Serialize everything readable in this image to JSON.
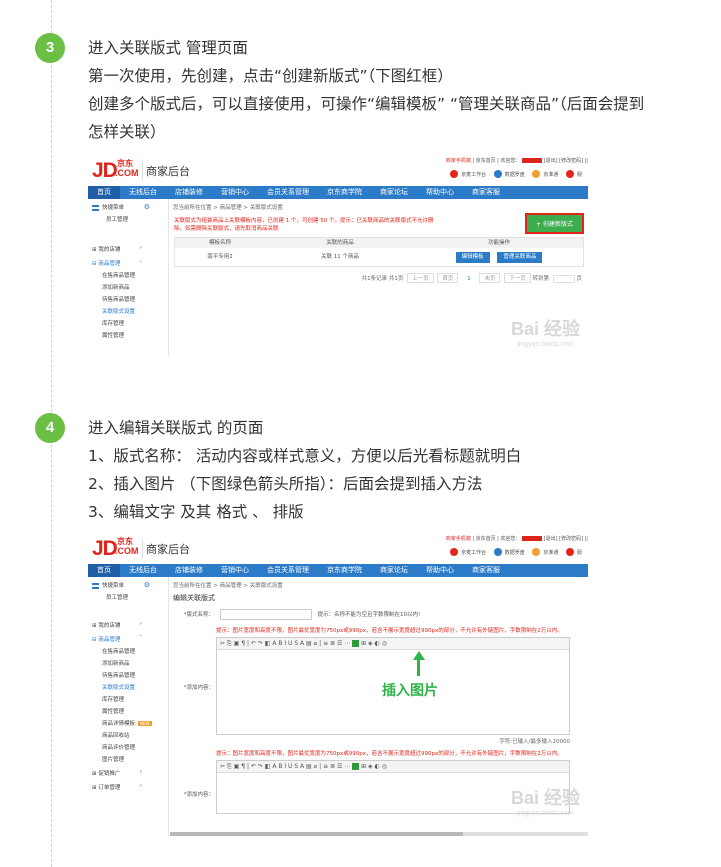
{
  "step3": {
    "number": "3",
    "lines": [
      "进入关联版式 管理页面",
      "第一次使用，先创建，点击“创建新版式”（下图红框）",
      "创建多个版式后，可以直接使用，可操作“编辑模板”   “管理关联商品”（后面会提到",
      "怎样关联）"
    ]
  },
  "step4": {
    "number": "4",
    "lines": [
      "进入编辑关联版式 的页面",
      "1、版式名称： 活动内容或样式意义，方便以后光看标题就明白",
      "2、插入图片 （下图绿色箭头所指）：后面会提到插入方法",
      "3、编辑文字 及其 格式 、 排版"
    ]
  },
  "shot_common": {
    "logo_main": "JD",
    "logo_cn": "京东",
    "logo_com": ".COM",
    "biz_title": "商家后台",
    "phone_link": "商家手机端",
    "top_links": "| 京东首页 | 欢迎您：",
    "top_links_tail": "[退出] [修改密码] ||",
    "tools": [
      "京麦工作台",
      "数据罗盘",
      "京准通",
      "服"
    ],
    "nav": [
      "首页",
      "无线后台",
      "店铺装修",
      "营销中心",
      "会员关系管理",
      "京东商学院",
      "商家论坛",
      "帮助中心",
      "商家客服"
    ],
    "watermark": "Bai 经验",
    "watermark_sub": "jingyan.baidu.com"
  },
  "shot1": {
    "side": {
      "quick_menu": "快捷菜单",
      "quick_sub": "员工管理",
      "groups": [
        {
          "label": "我的店铺",
          "chev": "›"
        },
        {
          "label": "商品管理",
          "chev": "›"
        }
      ],
      "items": [
        "在售商品管理",
        "添加新商品",
        "待售商品管理",
        "关联版式设置",
        "库存管理",
        "属性管理"
      ]
    },
    "crumb": "您当前所在位置 > 商品管理 > 关联版式设置",
    "tip": "关联版式为组装商品上关联模板内容，已创建 1 个，可创建 50 个。提示：已关联商品的关联版式不允许删除，如需删除关联版式，请先取消商品关联",
    "create_btn": "+ 创建新版式",
    "headers": [
      "模板名称",
      "关联的商品",
      "功能操作"
    ],
    "row": {
      "name": "南平专用2",
      "products": "关联 11 个商品",
      "edit_btn": "编辑模板",
      "manage_btn": "管理关联商品"
    },
    "pager": {
      "summary": "共1条记录  共1页",
      "first": "上一页",
      "prev": "首页",
      "current": "1",
      "next": "末页",
      "last": "下一页",
      "goto": "转到第",
      "go": "页"
    }
  },
  "shot2": {
    "side": {
      "quick_menu": "快捷菜单",
      "quick_sub": "员工管理",
      "groups": [
        {
          "label": "我的店铺",
          "chev": "›"
        },
        {
          "label": "商品管理",
          "chev": "˅"
        }
      ],
      "items": [
        "在售商品管理",
        "添加新商品",
        "待售商品管理",
        "关联版式设置",
        "库存管理",
        "属性管理",
        "商品详情模板",
        "商品回收站",
        "商品评价管理",
        "图片管理"
      ],
      "badge": "NEW",
      "bottom_groups": [
        {
          "label": "促销推广",
          "chev": "›"
        },
        {
          "label": "订单管理",
          "chev": "›"
        }
      ]
    },
    "crumb": "您当前所在位置 > 商品管理 > 关联版式设置",
    "page_title": "编辑关联版式",
    "name_label": "*版式名称：",
    "name_hint": "提示：名称不能为空且字数限制在10以内!",
    "img_tip": "提示：图片宽度和高度不限，图片最优宽度为750px或990px，若含不展示宽度超过990px的部分，不允许有外链图片，字数限制在2万以内。",
    "content_label": "*添加内容：",
    "toolbar": "✂ ⎘ ▣ ¶ | ↶ ↷ ◧ A B I U S A ▤ ⌀ | ≡ ≣ ☰ ⋯",
    "toolbar_tail": "⊞ ◈ ◐ ◎",
    "insert_label": "插入图片",
    "counter": "字符:已输入/最多输入20000",
    "content_label2": "*添加内容："
  }
}
